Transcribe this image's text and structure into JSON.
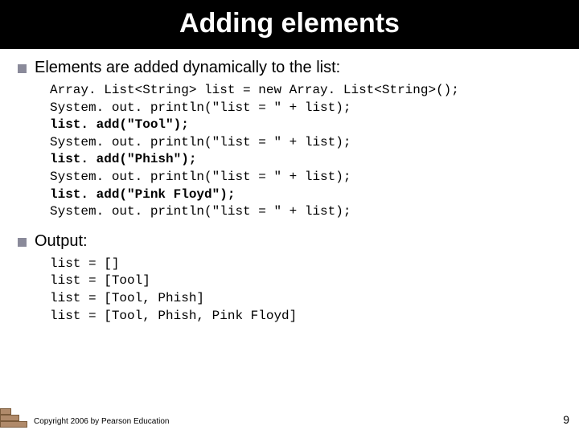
{
  "title": "Adding elements",
  "bullets": {
    "b1": "Elements are added dynamically to the list:",
    "b2": "Output:"
  },
  "code1": "Array. List<String> list = new Array. List<String>();\nSystem. out. println(\"list = \" + list);\nlist. add(\"Tool\");\nSystem. out. println(\"list = \" + list);\nlist. add(\"Phish\");\nSystem. out. println(\"list = \" + list);\nlist. add(\"Pink Floyd\");\nSystem. out. println(\"list = \" + list);",
  "code2": "list = []\nlist = [Tool]\nlist = [Tool, Phish]\nlist = [Tool, Phish, Pink Floyd]",
  "footer": {
    "copyright": "Copyright 2006 by Pearson Education",
    "page": "9"
  }
}
